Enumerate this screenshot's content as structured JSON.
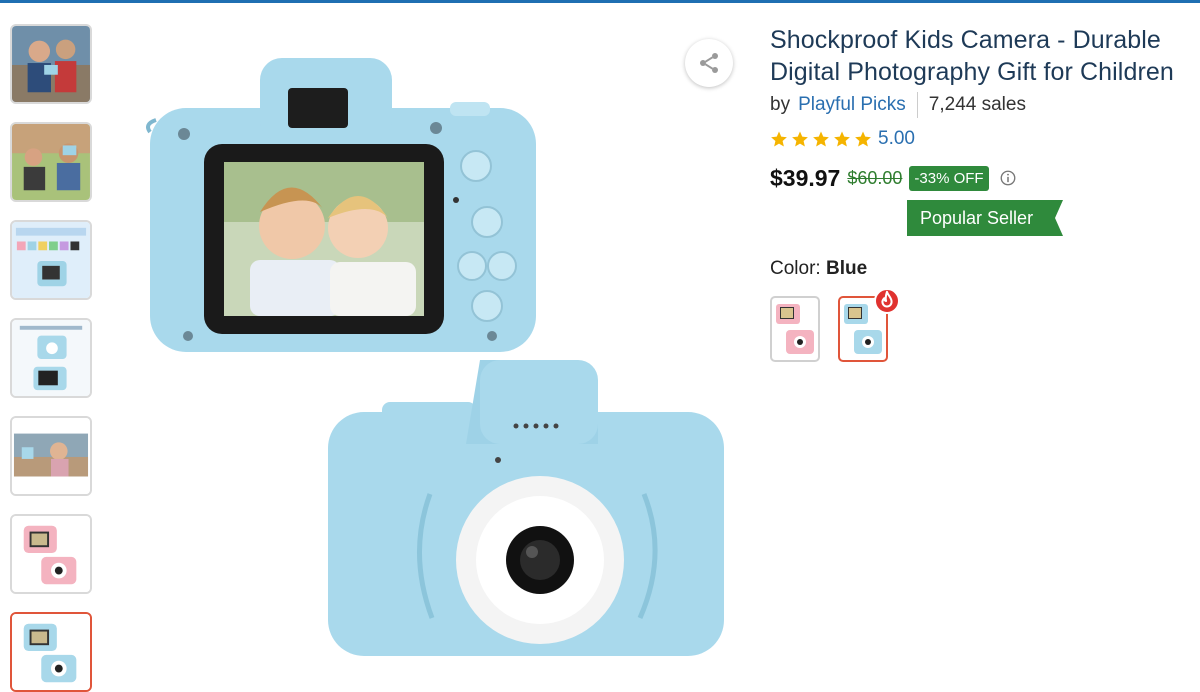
{
  "product": {
    "title": "Shockproof Kids Camera - Durable Digital Photography Gift for Children",
    "by_label": "by",
    "seller": "Playful Picks",
    "sales": "7,244 sales",
    "rating_value": "5.00",
    "rating_stars": 5,
    "price": "$39.97",
    "original_price": "$60.00",
    "discount": "-33% OFF",
    "badge": "Popular Seller"
  },
  "color": {
    "label": "Color:",
    "selected": "Blue",
    "options": [
      {
        "name": "Pink",
        "selected": false
      },
      {
        "name": "Blue",
        "selected": true
      }
    ]
  },
  "gallery": {
    "thumbnail_count": 7,
    "active_index": 6
  },
  "colors": {
    "accent": "#e0553a",
    "seller_link": "#2a6fb0",
    "title": "#1e3a57",
    "discount_green": "#2f8a3c",
    "star": "#f5b400",
    "camera_blue": "#a8d8ea"
  },
  "icons": {
    "share": "share-icon",
    "info": "info-circle-icon",
    "hot": "flame-icon",
    "star": "star-icon"
  }
}
